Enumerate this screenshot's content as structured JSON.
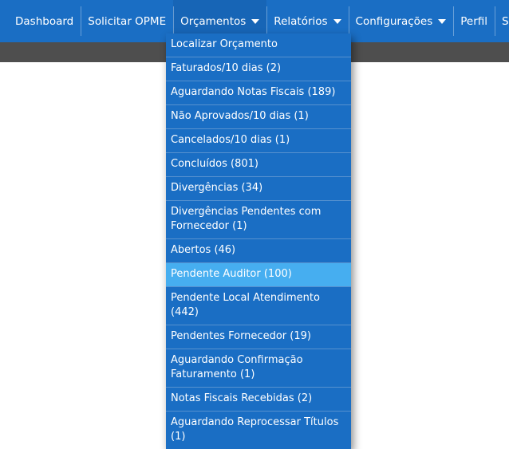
{
  "nav": {
    "items": [
      {
        "label": "Dashboard"
      },
      {
        "label": "Solicitar OPME"
      },
      {
        "label": "Orçamentos"
      },
      {
        "label": "Relatórios"
      },
      {
        "label": "Configurações"
      },
      {
        "label": "Perfil"
      },
      {
        "label": "Sair"
      }
    ]
  },
  "orcamentos_menu": {
    "items": [
      {
        "label": "Localizar Orçamento"
      },
      {
        "label": "Faturados/10 dias (2)"
      },
      {
        "label": "Aguardando Notas Fiscais (189)"
      },
      {
        "label": "Não Aprovados/10 dias (1)"
      },
      {
        "label": "Cancelados/10 dias (1)"
      },
      {
        "label": "Concluídos (801)"
      },
      {
        "label": "Divergências (34)"
      },
      {
        "label": "Divergências Pendentes com Fornecedor (1)"
      },
      {
        "label": "Abertos (46)"
      },
      {
        "label": "Pendente Auditor (100)"
      },
      {
        "label": "Pendente Local Atendimento (442)"
      },
      {
        "label": "Pendentes Fornecedor (19)"
      },
      {
        "label": "Aguardando Confirmação Faturamento (1)"
      },
      {
        "label": "Notas Fiscais Recebidas (2)"
      },
      {
        "label": "Aguardando Reprocessar Títulos (1)"
      }
    ]
  },
  "colors": {
    "navbar": "#1a6ec4",
    "subbar": "#4e4e4e",
    "highlight": "#46aef0"
  },
  "icons": {
    "dropdown_caret": "caret-down-icon"
  }
}
